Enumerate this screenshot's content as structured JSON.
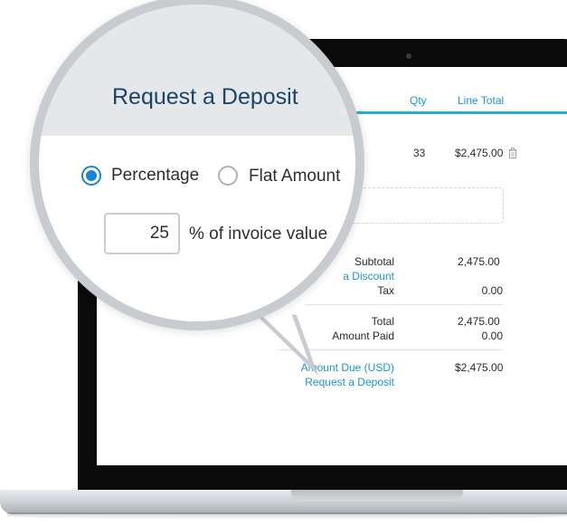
{
  "deposit_popup": {
    "title": "Request a Deposit",
    "options": [
      {
        "label": "Percentage",
        "selected": true
      },
      {
        "label": "Flat Amount",
        "selected": false
      }
    ],
    "amount_value": "25",
    "amount_suffix": "% of invoice value"
  },
  "invoice": {
    "columns": {
      "qty": "Qty",
      "line_total": "Line Total"
    },
    "line_item": {
      "qty": "33",
      "line_total": "$2,475.00"
    },
    "subtotal_label": "Subtotal",
    "subtotal_value": "2,475.00",
    "discount_link": "a Discount",
    "tax_label": "Tax",
    "tax_value": "0.00",
    "total_label": "Total",
    "total_value": "2,475.00",
    "amount_paid_label": "Amount Paid",
    "amount_paid_value": "0.00",
    "amount_due_label": "Amount Due (USD)",
    "amount_due_value": "$2,475.00",
    "request_deposit_link": "Request a Deposit"
  },
  "colors": {
    "accent": "#1a83d6",
    "link": "#1a96d2",
    "teal_bar": "#23b1c7",
    "title": "#1d4466"
  },
  "icons": {
    "delete": "trash-icon"
  }
}
